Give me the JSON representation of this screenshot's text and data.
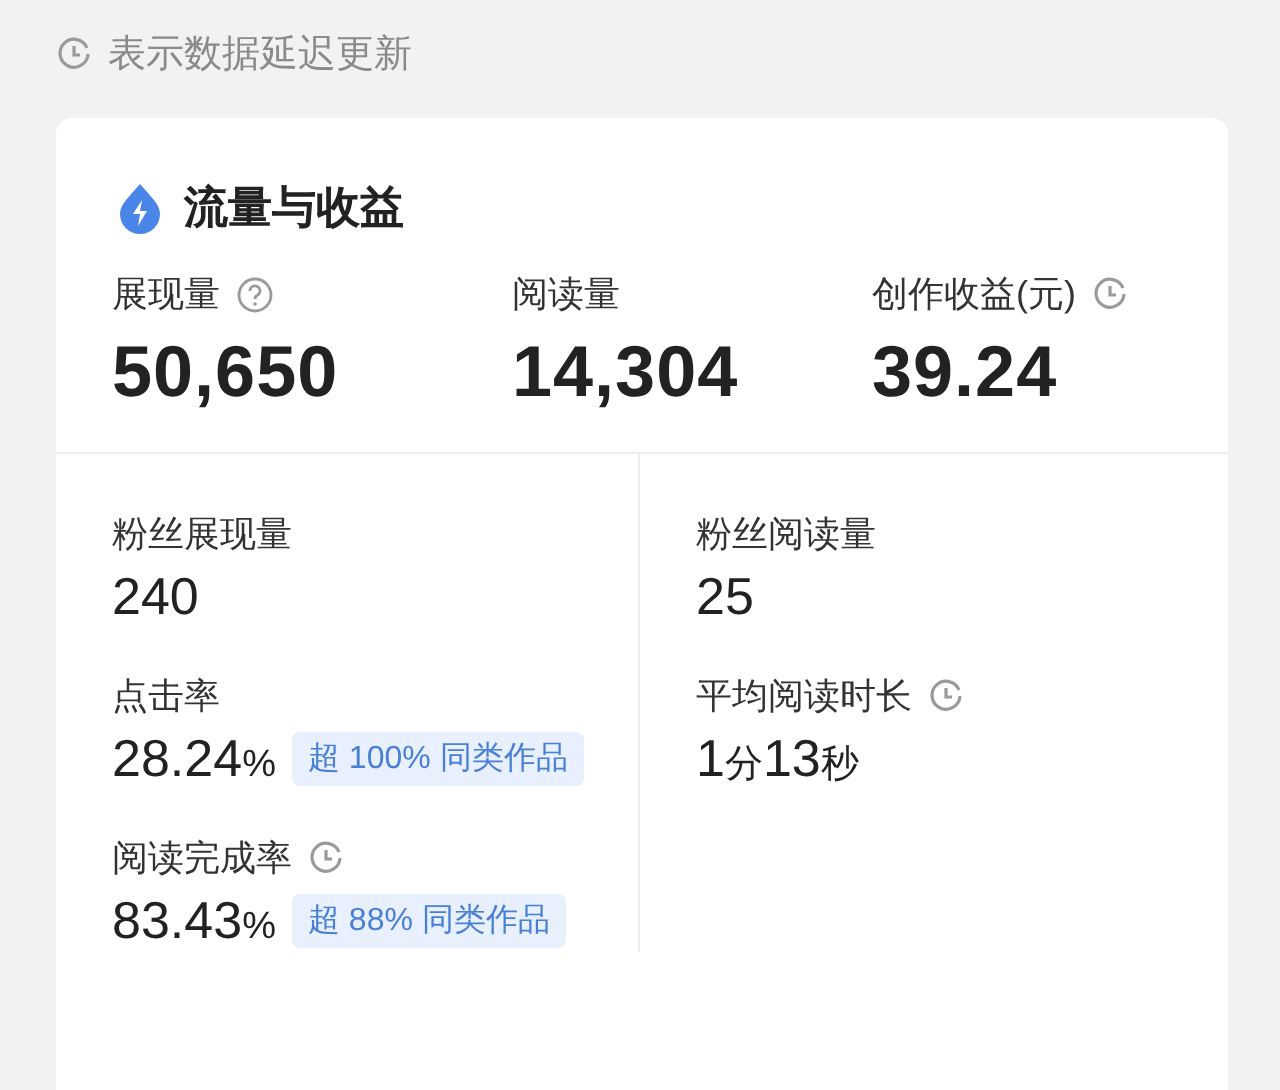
{
  "notice": {
    "text": "表示数据延迟更新"
  },
  "card": {
    "title": "流量与收益",
    "primary": [
      {
        "kind": "help",
        "label": "展现量",
        "value": "50,650"
      },
      {
        "kind": "plain",
        "label": "阅读量",
        "value": "14,304"
      },
      {
        "kind": "delayed",
        "label": "创作收益(元)",
        "value": "39.24"
      }
    ],
    "columns": [
      [
        {
          "kind": "plain",
          "label": "粉丝展现量",
          "value": "240"
        },
        {
          "kind": "plain",
          "label": "点击率",
          "value": "28.24%",
          "badge": "超 100% 同类作品"
        },
        {
          "kind": "delayed",
          "label": "阅读完成率",
          "value": "83.43%",
          "badge": "超 88% 同类作品"
        }
      ],
      [
        {
          "kind": "plain",
          "label": "粉丝阅读量",
          "value": "25"
        },
        {
          "kind": "delayed",
          "label": "平均阅读时长",
          "value": "1分13秒"
        }
      ]
    ]
  }
}
